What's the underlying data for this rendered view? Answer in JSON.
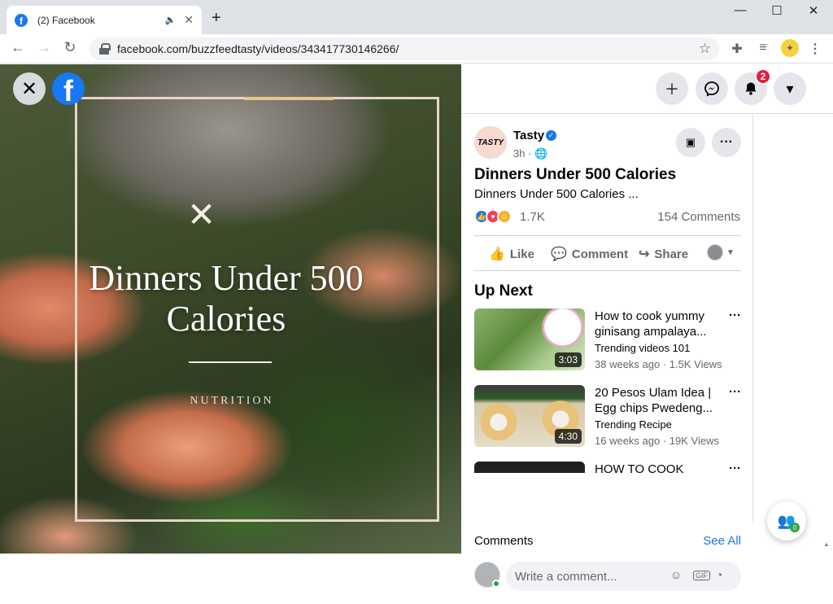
{
  "browser": {
    "tab_title": "(2) Facebook",
    "url": "facebook.com/buzzfeedtasty/videos/343417730146266/",
    "new_tab_label": "+"
  },
  "video": {
    "title_line1": "Dinners Under 500",
    "title_line2": "Calories",
    "subtitle": "NUTRITION"
  },
  "header": {
    "notification_count": "2"
  },
  "post": {
    "page_name": "Tasty",
    "time": "3h · ",
    "title": "Dinners Under 500 Calories",
    "description": "Dinners Under 500 Calories ...",
    "reaction_count": "1.7K",
    "comment_count": "154 Comments",
    "avatar_text": "TASTY"
  },
  "actions": {
    "like": "Like",
    "comment": "Comment",
    "share": "Share"
  },
  "up_next": {
    "heading": "Up Next",
    "items": [
      {
        "title": "How to cook yummy ginisang ampalaya...",
        "channel": "Trending videos 101",
        "meta": "38 weeks ago · 1.5K Views",
        "duration": "3:03"
      },
      {
        "title": "20 Pesos Ulam Idea | Egg chips Pwedeng...",
        "channel": "Trending Recipe",
        "meta": "16 weeks ago · 19K Views",
        "duration": "4:30"
      },
      {
        "title": "HOW TO COOK",
        "channel": "",
        "meta": "",
        "duration": ""
      }
    ]
  },
  "comments": {
    "label": "Comments",
    "see_all": "See All",
    "placeholder": "Write a comment..."
  },
  "chat": {
    "count": "0"
  },
  "colors": {
    "facebook_blue": "#1877f2",
    "badge_red": "#e41e3f",
    "online_green": "#31a24c"
  },
  "icons": [
    "facebook-icon",
    "audio-icon",
    "close-icon",
    "back-icon",
    "forward-icon",
    "reload-icon",
    "lock-icon",
    "star-icon",
    "extensions-icon",
    "media-icon",
    "profile-icon",
    "kebab-icon",
    "plus-icon",
    "messenger-icon",
    "bell-icon",
    "caret-down-icon",
    "verified-icon",
    "globe-icon",
    "save-icon",
    "more-icon",
    "like-icon",
    "love-icon",
    "care-icon",
    "comment-icon",
    "share-icon",
    "emoji-icon",
    "gif-icon",
    "sticker-icon",
    "friends-icon"
  ]
}
